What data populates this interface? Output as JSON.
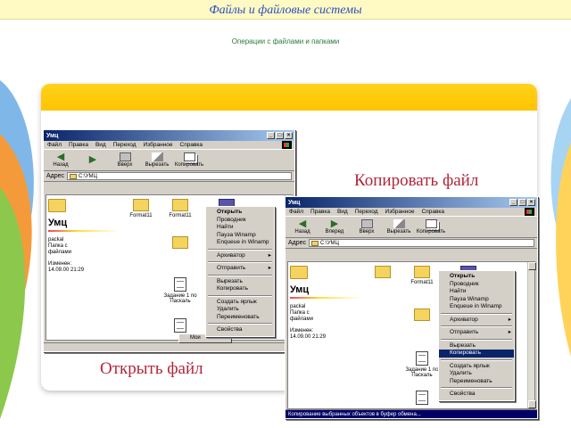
{
  "header": {
    "title": "Файлы и файловые системы",
    "subtitle": "Операции с файлами и папками"
  },
  "captions": {
    "copy": "Копировать файл",
    "open": "Открыть файл"
  },
  "colors": {
    "header_bg": "#fff9c4",
    "title_text": "#2a4fc0",
    "caption_text": "#b0263a",
    "band": "#ffc400",
    "titlebar": "#0a246a",
    "menu_selection": "#0a246a"
  },
  "window1": {
    "title": "Умц",
    "menu": [
      "Файл",
      "Правка",
      "Вид",
      "Переход",
      "Избранное",
      "Справка"
    ],
    "toolbar": [
      "Назад",
      "",
      "Вверх",
      "Вырезать",
      "Копировать"
    ],
    "address_label": "Адрес",
    "address_value": "C:\\УМЦ",
    "pane": {
      "name": "Умц",
      "lines": [
        "packal",
        "Папка с",
        "файлами"
      ],
      "modified": [
        "Изменен:",
        "14.09.00 21:29"
      ]
    },
    "icons": [
      "Format11",
      "",
      "10",
      "",
      "",
      "Задание 1 по Паскаль",
      "Тп",
      "",
      "",
      ""
    ],
    "status": "Мои"
  },
  "context_menu1": {
    "items": [
      "Открыть",
      "Проводник",
      "Найти",
      "Пауза Winamp",
      "Enqueue in Winamp",
      "Архиватор",
      "Отправить",
      "Вырезать",
      "Копировать",
      "Создать ярлык",
      "Удалить",
      "Переименовать",
      "Свойства"
    ],
    "submenu": [
      "Архиватор",
      "Отправить"
    ]
  },
  "window2": {
    "title": "Умц",
    "menu": [
      "Файл",
      "Правка",
      "Вид",
      "Переход",
      "Избранное",
      "Справка"
    ],
    "toolbar": [
      "Назад",
      "Вперед",
      "Вверх",
      "Вырезать",
      "Копировать"
    ],
    "address_label": "Адрес",
    "address_value": "C:\\УМЦ",
    "pane": {
      "name": "Умц",
      "lines": [
        "packal",
        "Папка с",
        "файлами"
      ],
      "modified": [
        "Изменен:",
        "14.09.00 21:29"
      ]
    },
    "icons": [
      "Format11",
      "",
      "",
      "",
      "",
      "",
      "Задание 1 по Паскаль",
      ""
    ],
    "status": "Копирование выбранных объектов в буфер обмена..."
  },
  "context_menu2": {
    "items": [
      "Открыть",
      "Проводник",
      "Найти",
      "Пауза Winamp",
      "Enqueue in Winamp",
      "Архиватор",
      "Отправить",
      "Вырезать",
      "Копировать",
      "Создать ярлык",
      "Удалить",
      "Переименовать",
      "Свойства"
    ],
    "submenu": [
      "Архиватор",
      "Отправить"
    ],
    "selected": "Копировать"
  }
}
